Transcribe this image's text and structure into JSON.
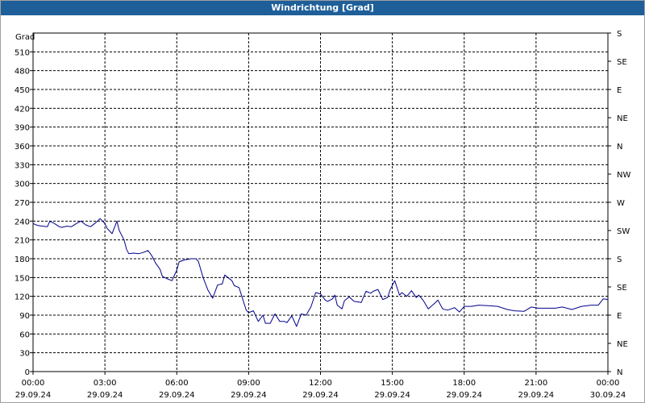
{
  "title": "Windrichtung [Grad]",
  "colors": {
    "title_bar": "#1e5f99",
    "line": "#00008b",
    "grid": "#000000"
  },
  "chart_data": {
    "type": "line",
    "title": "Windrichtung [Grad]",
    "ylabel": "Grad",
    "ylim": [
      0,
      540
    ],
    "xlim": [
      "29.09.24 00:00",
      "30.09.24 00:00"
    ],
    "y_ticks": [
      0,
      30,
      60,
      90,
      120,
      150,
      180,
      210,
      240,
      270,
      300,
      330,
      360,
      390,
      420,
      450,
      480,
      510
    ],
    "y2_ticks": [
      {
        "value": 0,
        "label": "N"
      },
      {
        "value": 45,
        "label": "NE"
      },
      {
        "value": 90,
        "label": "E"
      },
      {
        "value": 135,
        "label": "SE"
      },
      {
        "value": 180,
        "label": "S"
      },
      {
        "value": 225,
        "label": "SW"
      },
      {
        "value": 270,
        "label": "W"
      },
      {
        "value": 315,
        "label": "NW"
      },
      {
        "value": 360,
        "label": "N"
      },
      {
        "value": 405,
        "label": "NE"
      },
      {
        "value": 450,
        "label": "E"
      },
      {
        "value": 495,
        "label": "SE"
      },
      {
        "value": 540,
        "label": "S"
      }
    ],
    "x_ticks": [
      {
        "value": 0,
        "time": "00:00",
        "date": "29.09.24"
      },
      {
        "value": 3,
        "time": "03:00",
        "date": "29.09.24"
      },
      {
        "value": 6,
        "time": "06:00",
        "date": "29.09.24"
      },
      {
        "value": 9,
        "time": "09:00",
        "date": "29.09.24"
      },
      {
        "value": 12,
        "time": "12:00",
        "date": "29.09.24"
      },
      {
        "value": 15,
        "time": "15:00",
        "date": "29.09.24"
      },
      {
        "value": 18,
        "time": "18:00",
        "date": "29.09.24"
      },
      {
        "value": 21,
        "time": "21:00",
        "date": "29.09.24"
      },
      {
        "value": 24,
        "time": "00:00",
        "date": "30.09.24"
      }
    ],
    "grid": true,
    "series": [
      {
        "x": [
          0,
          0.2,
          0.4,
          0.6,
          0.7,
          0.9,
          1.1,
          1.2,
          1.4,
          1.6,
          1.8,
          2.0,
          2.2,
          2.4,
          2.6,
          2.8,
          3.0,
          3.1,
          3.3,
          3.5,
          3.6,
          3.8,
          3.9,
          4.0,
          4.2,
          4.4,
          4.6,
          4.8,
          4.9,
          5.0,
          5.1,
          5.3,
          5.4,
          5.6,
          5.8,
          6.0,
          6.1,
          6.3,
          6.6,
          6.8,
          6.9,
          7.1,
          7.3,
          7.5,
          7.7,
          7.9,
          8.0,
          8.3,
          8.4,
          8.6,
          8.8,
          8.9,
          9.0,
          9.2,
          9.4,
          9.6,
          9.7,
          9.9,
          10.1,
          10.3,
          10.5,
          10.6,
          10.8,
          11.0,
          11.2,
          11.4,
          11.6,
          11.8,
          12.0,
          12.2,
          12.3,
          12.5,
          12.6,
          12.7,
          12.9,
          13.0,
          13.2,
          13.4,
          13.6,
          13.7,
          13.9,
          14.1,
          14.2,
          14.4,
          14.6,
          14.8,
          14.9,
          15.1,
          15.3,
          15.4,
          15.6,
          15.8,
          16.0,
          16.1,
          16.3,
          16.5,
          16.8,
          16.9,
          17.1,
          17.3,
          17.6,
          17.8,
          18.0,
          18.3,
          18.6,
          19.0,
          19.4,
          19.8,
          20.1,
          20.5,
          20.8,
          21.1,
          21.5,
          21.8,
          22.1,
          22.5,
          22.9,
          23.3,
          23.6,
          23.8,
          24.0
        ],
        "y": [
          236,
          233,
          232,
          231,
          240,
          236,
          231,
          230,
          232,
          231,
          236,
          240,
          234,
          231,
          237,
          244,
          236,
          228,
          220,
          240,
          225,
          210,
          195,
          188,
          189,
          188,
          190,
          193,
          188,
          182,
          174,
          163,
          152,
          148,
          145,
          162,
          175,
          178,
          180,
          180,
          176,
          150,
          130,
          117,
          138,
          140,
          154,
          145,
          137,
          134,
          110,
          98,
          94,
          97,
          80,
          90,
          77,
          77,
          92,
          80,
          80,
          78,
          89,
          72,
          92,
          90,
          103,
          126,
          124,
          114,
          112,
          116,
          122,
          106,
          100,
          113,
          119,
          112,
          111,
          110,
          128,
          125,
          128,
          131,
          115,
          118,
          130,
          145,
          122,
          126,
          120,
          129,
          118,
          122,
          113,
          100,
          110,
          114,
          100,
          98,
          102,
          95,
          104,
          104,
          106,
          105,
          104,
          99,
          97,
          96,
          103,
          101,
          101,
          101,
          103,
          99,
          104,
          106,
          106,
          116,
          115
        ]
      }
    ]
  }
}
